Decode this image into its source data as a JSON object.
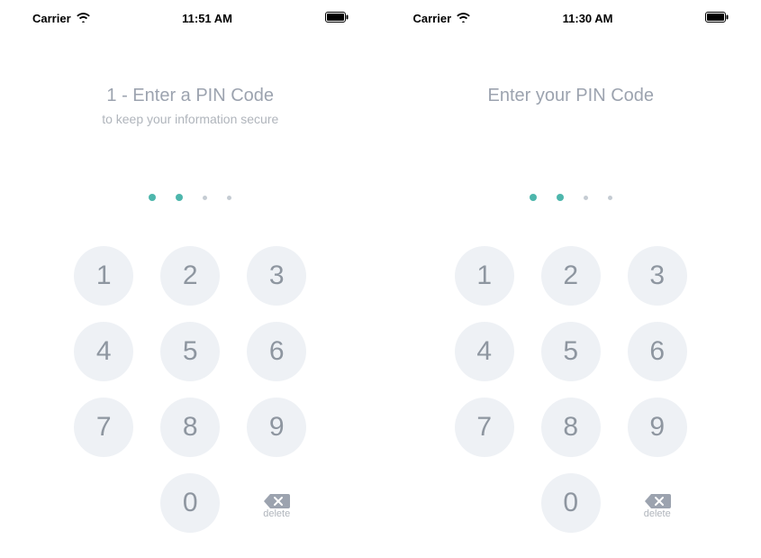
{
  "screens": [
    {
      "status_bar": {
        "carrier": "Carrier",
        "time": "11:51 AM"
      },
      "title": "1 - Enter a PIN Code",
      "subtitle": "to keep your information secure",
      "pin_dots": [
        true,
        true,
        false,
        false
      ],
      "keypad": {
        "rows": [
          [
            "1",
            "2",
            "3"
          ],
          [
            "4",
            "5",
            "6"
          ],
          [
            "7",
            "8",
            "9"
          ]
        ],
        "zero": "0",
        "delete_label": "delete"
      }
    },
    {
      "status_bar": {
        "carrier": "Carrier",
        "time": "11:30 AM"
      },
      "title": "Enter your PIN Code",
      "subtitle": "",
      "pin_dots": [
        true,
        true,
        false,
        false
      ],
      "keypad": {
        "rows": [
          [
            "1",
            "2",
            "3"
          ],
          [
            "4",
            "5",
            "6"
          ],
          [
            "7",
            "8",
            "9"
          ]
        ],
        "zero": "0",
        "delete_label": "delete"
      }
    }
  ],
  "colors": {
    "accent": "#4db6ac",
    "key_bg": "#eef1f5",
    "text_muted": "#9ca3af"
  }
}
